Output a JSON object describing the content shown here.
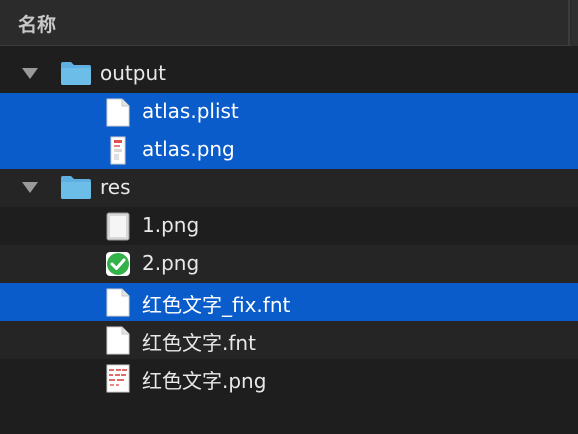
{
  "header": {
    "title": "名称"
  },
  "rows": [
    {
      "label": "output",
      "kind": "folder"
    },
    {
      "label": "atlas.plist",
      "kind": "document"
    },
    {
      "label": "atlas.png",
      "kind": "image-preview"
    },
    {
      "label": "res",
      "kind": "folder"
    },
    {
      "label": "1.png",
      "kind": "blank-image"
    },
    {
      "label": "2.png",
      "kind": "green-check-image"
    },
    {
      "label": "红色文字_fix.fnt",
      "kind": "document"
    },
    {
      "label": "红色文字.fnt",
      "kind": "document"
    },
    {
      "label": "红色文字.png",
      "kind": "red-text-image"
    }
  ],
  "colors": {
    "selection": "#0a5ccb",
    "folder": "#5fb0e0",
    "background": "#1e1e1e",
    "stripe": "#252525"
  }
}
